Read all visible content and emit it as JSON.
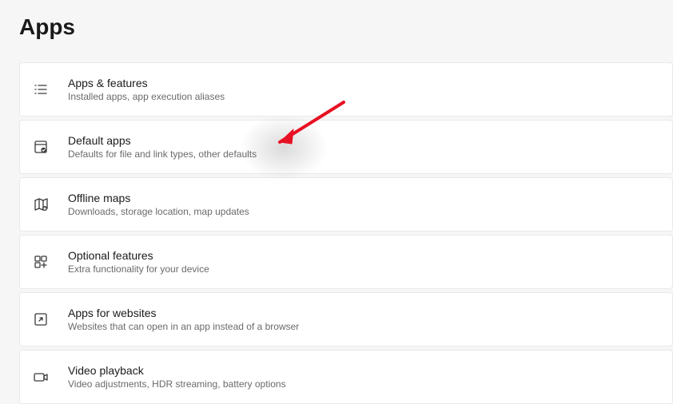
{
  "page": {
    "title": "Apps"
  },
  "items": [
    {
      "title": "Apps & features",
      "desc": "Installed apps, app execution aliases"
    },
    {
      "title": "Default apps",
      "desc": "Defaults for file and link types, other defaults"
    },
    {
      "title": "Offline maps",
      "desc": "Downloads, storage location, map updates"
    },
    {
      "title": "Optional features",
      "desc": "Extra functionality for your device"
    },
    {
      "title": "Apps for websites",
      "desc": "Websites that can open in an app instead of a browser"
    },
    {
      "title": "Video playback",
      "desc": "Video adjustments, HDR streaming, battery options"
    }
  ]
}
